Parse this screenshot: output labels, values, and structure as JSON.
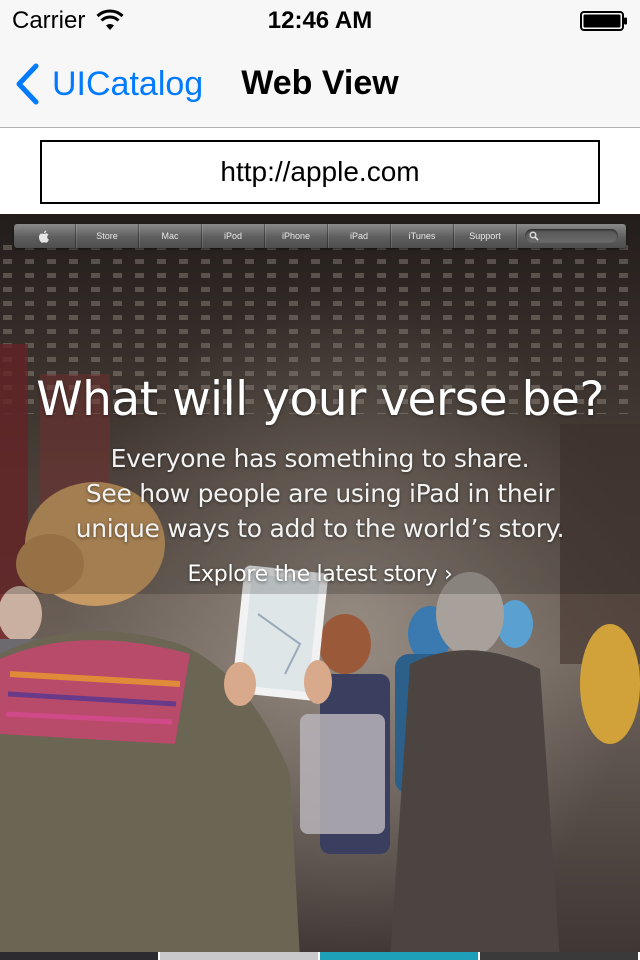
{
  "status_bar": {
    "carrier": "Carrier",
    "time": "12:46 AM"
  },
  "nav_bar": {
    "back_label": "UICatalog",
    "title": "Web View",
    "tint_color": "#007aff"
  },
  "url_field": {
    "value": "http://apple.com"
  },
  "web_page": {
    "nav_items": [
      "Store",
      "Mac",
      "iPod",
      "iPhone",
      "iPad",
      "iTunes",
      "Support"
    ],
    "headline": "What will your verse be?",
    "subtext": [
      "Everyone has something to share.",
      "See how people are using iPad in their",
      "unique ways to add to the world’s story."
    ],
    "cta_link": "Explore the latest story ›"
  }
}
